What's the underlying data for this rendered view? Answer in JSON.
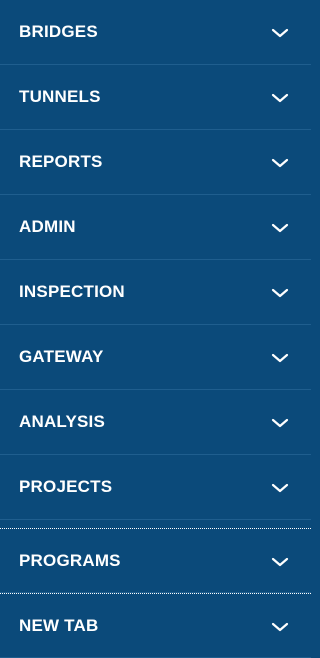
{
  "nav": {
    "items": [
      {
        "label": "BRIDGES",
        "icon": "chevron-down-icon"
      },
      {
        "label": "TUNNELS",
        "icon": "chevron-down-icon"
      },
      {
        "label": "REPORTS",
        "icon": "chevron-down-icon"
      },
      {
        "label": "ADMIN",
        "icon": "chevron-down-icon"
      },
      {
        "label": "INSPECTION",
        "icon": "chevron-down-icon"
      },
      {
        "label": "GATEWAY",
        "icon": "chevron-down-icon"
      },
      {
        "label": "ANALYSIS",
        "icon": "chevron-down-icon"
      },
      {
        "label": "PROJECTS",
        "icon": "chevron-down-icon"
      },
      {
        "label": "PROGRAMS",
        "icon": "chevron-down-icon"
      },
      {
        "label": "NEW TAB",
        "icon": "chevron-down-icon"
      }
    ]
  },
  "colors": {
    "background": "#0b4a7a",
    "text": "#ffffff",
    "separator": "#1f5e8e"
  }
}
